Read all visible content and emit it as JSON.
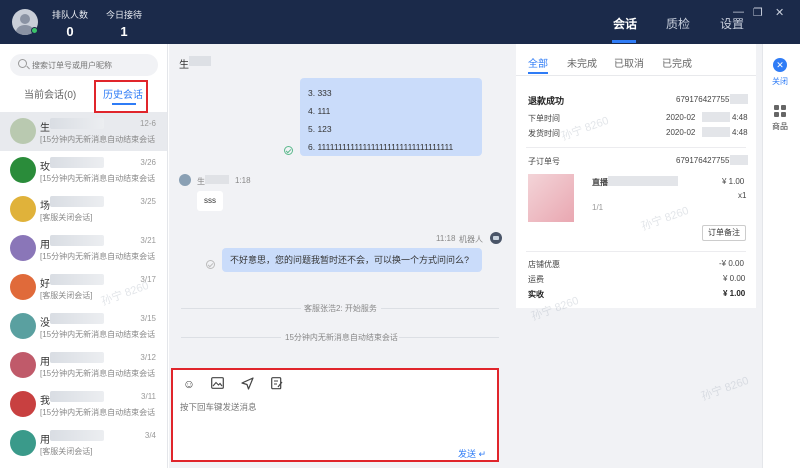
{
  "topbar": {
    "stats": [
      {
        "label": "排队人数",
        "value": "0"
      },
      {
        "label": "今日接待",
        "value": "1"
      }
    ],
    "nav": [
      {
        "label": "会话",
        "active": true
      },
      {
        "label": "质检",
        "active": false
      },
      {
        "label": "设置",
        "active": false
      }
    ],
    "window": {
      "minimize": "—",
      "restore": "❐",
      "close": "✕"
    }
  },
  "sidebar": {
    "search_placeholder": "搜索订单号或用户昵称",
    "tabs": [
      {
        "label": "当前会话(0)",
        "active": false
      },
      {
        "label": "历史会话",
        "active": true
      }
    ],
    "conversations": [
      {
        "name": "生",
        "date": "12-6",
        "msg": "[15分钟内无新消息自动结束会话",
        "color": "#b9c9b0"
      },
      {
        "name": "玫",
        "date": "3/26",
        "msg": "[15分钟内无新消息自动结束会话",
        "color": "#2a8c3a"
      },
      {
        "name": "场",
        "date": "3/25",
        "msg": "[客服关闭会话]",
        "color": "#e0b23a"
      },
      {
        "name": "用",
        "date": "3/21",
        "msg": "[15分钟内无新消息自动结束会话",
        "color": "#8a76b8"
      },
      {
        "name": "好",
        "date": "3/17",
        "msg": "[客服关闭会话]",
        "color": "#e06a3a"
      },
      {
        "name": "没",
        "date": "3/15",
        "msg": "[15分钟内无新消息自动结束会话",
        "color": "#5aa0a0"
      },
      {
        "name": "用",
        "date": "3/12",
        "msg": "[15分钟内无新消息自动结束会话",
        "color": "#c05a6a"
      },
      {
        "name": "我",
        "date": "3/11",
        "msg": "[15分钟内无新消息自动结束会话",
        "color": "#c84040"
      },
      {
        "name": "用",
        "date": "3/4",
        "msg": "[客服关闭会话]",
        "color": "#3a9a8a"
      }
    ]
  },
  "chat": {
    "title": "生",
    "list_message": [
      "3. 333",
      "4. 111",
      "5. 123",
      "6. 111111111111111111111111111111111"
    ],
    "customer": {
      "name": "生",
      "time": "1:18",
      "message": "sss"
    },
    "robot": {
      "time": "11:18",
      "label": "机器人",
      "message": "不好意思，您的问题我暂时还不会，可以换一个方式问问么?"
    },
    "system_messages": [
      "客服张浩2: 开始服务",
      "15分钟内无新消息自动结束会话"
    ],
    "input_placeholder": "按下回车键发送消息",
    "send_label": "发送 ↵",
    "toolbar_icons": [
      "emoji-icon",
      "image-icon",
      "send-plane-icon",
      "edit-icon"
    ]
  },
  "order": {
    "tabs": [
      {
        "label": "全部",
        "active": true
      },
      {
        "label": "未完成",
        "active": false
      },
      {
        "label": "已取消",
        "active": false
      },
      {
        "label": "已完成",
        "active": false
      }
    ],
    "status": "退款成功",
    "order_no": "67917642775574",
    "order_time_label": "下单时间",
    "order_time": "2020-02",
    "order_time_suffix": "4:48",
    "ship_time_label": "发货时间",
    "ship_time": "2020-02",
    "ship_time_suffix": "4:48",
    "sub_order_label": "子订单号",
    "sub_order_no": "67917642775574",
    "product_name": "直播",
    "product_price": "¥ 1.00",
    "product_qty": "x1",
    "product_page": "1/1",
    "note_button": "订单备注",
    "shop_discount_label": "店铺优惠",
    "shop_discount": "-¥ 0.00",
    "shipping_label": "运费",
    "shipping": "¥ 0.00",
    "paid_label": "实收",
    "paid": "¥ 1.00"
  },
  "right_sidebar": {
    "close_label": "关闭",
    "goods_label": "商品"
  },
  "watermark": "孙宁 8260"
}
